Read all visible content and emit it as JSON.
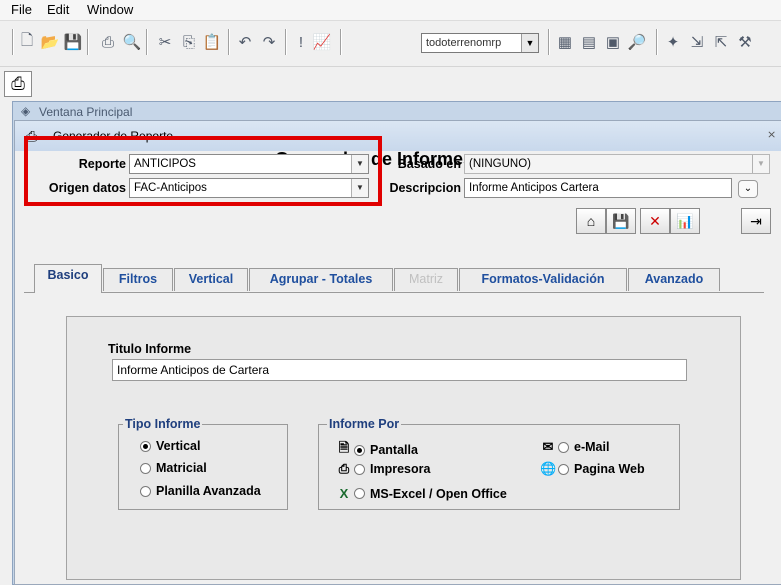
{
  "menu": {
    "file": "File",
    "edit": "Edit",
    "window": "Window"
  },
  "toolbar": {
    "combo_value": "todoterrenomrp"
  },
  "main_window": {
    "title": "Ventana Principal"
  },
  "dialog": {
    "title": "Generador de Reporte",
    "heading": "Generador de Informes",
    "close_label": "⨯",
    "fields": {
      "reporte_label": "Reporte",
      "reporte_value": "ANTICIPOS",
      "origen_label": "Origen datos",
      "origen_value": "FAC-Anticipos",
      "basado_label": "Basado en",
      "basado_value": "(NINGUNO)",
      "descripcion_label": "Descripcion",
      "descripcion_value": "Informe Anticipos Cartera"
    },
    "tabs": [
      {
        "label": "Basico"
      },
      {
        "label": "Filtros"
      },
      {
        "label": "Vertical"
      },
      {
        "label": "Agrupar - Totales"
      },
      {
        "label": "Matriz"
      },
      {
        "label": "Formatos-Validación"
      },
      {
        "label": "Avanzado"
      }
    ],
    "titulo_label": "Titulo Informe",
    "titulo_value": "Informe Anticipos de Cartera",
    "tipo_group": {
      "title": "Tipo Informe",
      "options": [
        "Vertical",
        "Matricial",
        "Planilla Avanzada"
      ],
      "selected": "Vertical"
    },
    "por_group": {
      "title": "Informe Por",
      "options": [
        "Pantalla",
        "Impresora",
        "MS-Excel / Open Office",
        "e-Mail",
        "Pagina Web"
      ],
      "selected": "Pantalla"
    }
  },
  "colors": {
    "highlight_box": "#e00000",
    "tab_text": "#1f4f9e"
  }
}
